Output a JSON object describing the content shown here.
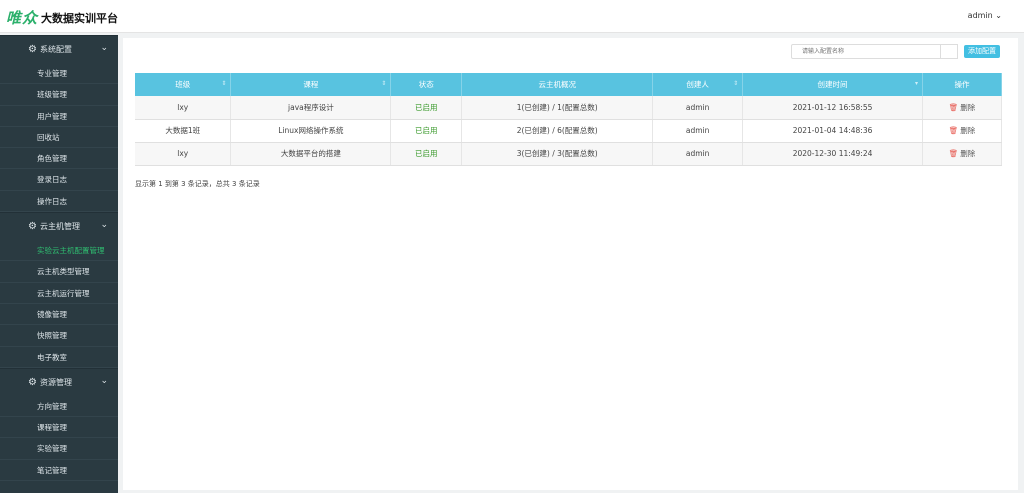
{
  "header": {
    "logo_mark": "唯众",
    "title": "大数据实训平台",
    "user": "admin"
  },
  "sidebar": {
    "sections": [
      {
        "label": "系统配置",
        "items": [
          "专业管理",
          "班级管理",
          "用户管理",
          "回收站",
          "角色管理",
          "登录日志",
          "操作日志"
        ]
      },
      {
        "label": "云主机管理",
        "items": [
          "实验云主机配置管理",
          "云主机类型管理",
          "云主机运行管理",
          "镜像管理",
          "快照管理",
          "电子教室"
        ]
      },
      {
        "label": "资源管理",
        "items": [
          "方向管理",
          "课程管理",
          "实验管理",
          "笔记管理"
        ]
      }
    ],
    "active": "实验云主机配置管理"
  },
  "toolbar": {
    "search_placeholder": "请输入配置名称",
    "add_label": "添加配置"
  },
  "table": {
    "headers": [
      "班级",
      "课程",
      "状态",
      "云主机概况",
      "创建人",
      "创建时间",
      "操作"
    ],
    "rows": [
      [
        "lxy",
        "java程序设计",
        "已启用",
        "1(已创建) / 1(配置总数)",
        "admin",
        "2021-01-12 16:58:55",
        "删除"
      ],
      [
        "大数据1班",
        "Linux网络操作系统",
        "已启用",
        "2(已创建) / 6(配置总数)",
        "admin",
        "2021-01-04 14:48:36",
        "删除"
      ],
      [
        "lxy",
        "大数据平台的搭建",
        "已启用",
        "3(已创建) / 3(配置总数)",
        "admin",
        "2020-12-30 11:49:24",
        "删除"
      ]
    ]
  },
  "pagination": {
    "info": "显示第 1 到第 3 条记录，总共 3 条记录"
  }
}
